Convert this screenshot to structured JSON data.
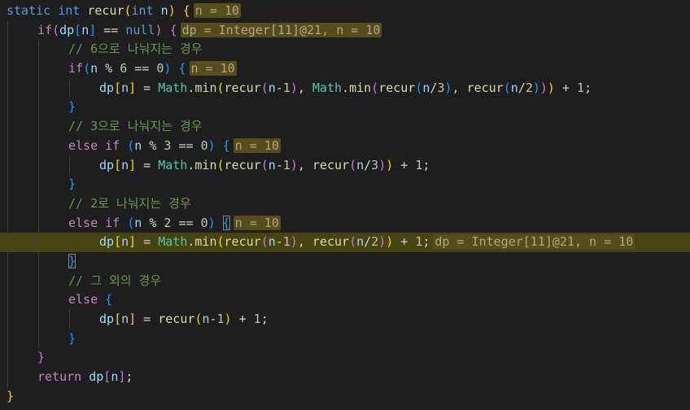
{
  "lines": [
    {
      "indent": 0,
      "tokens": [
        {
          "c": "kw",
          "t": "static"
        },
        {
          "c": "op",
          "t": " "
        },
        {
          "c": "kw",
          "t": "int"
        },
        {
          "c": "op",
          "t": " "
        },
        {
          "c": "fn",
          "t": "recur"
        },
        {
          "c": "b1",
          "t": "("
        },
        {
          "c": "kw",
          "t": "int"
        },
        {
          "c": "op",
          "t": " "
        },
        {
          "c": "var",
          "t": "n"
        },
        {
          "c": "b1",
          "t": ")"
        },
        {
          "c": "op",
          "t": " "
        },
        {
          "c": "b1",
          "t": "{"
        },
        {
          "c": "inl",
          "t": "n = 10"
        }
      ]
    },
    {
      "indent": 1,
      "tokens": [
        {
          "c": "ctl",
          "t": "if"
        },
        {
          "c": "b2",
          "t": "("
        },
        {
          "c": "var",
          "t": "dp"
        },
        {
          "c": "b3",
          "t": "["
        },
        {
          "c": "var",
          "t": "n"
        },
        {
          "c": "b3",
          "t": "]"
        },
        {
          "c": "op",
          "t": " == "
        },
        {
          "c": "kw",
          "t": "null"
        },
        {
          "c": "b2",
          "t": ")"
        },
        {
          "c": "op",
          "t": " "
        },
        {
          "c": "b2",
          "t": "{"
        },
        {
          "c": "inl",
          "t": "dp = Integer[11]@21, n = 10"
        }
      ]
    },
    {
      "indent": 2,
      "tokens": [
        {
          "c": "cm",
          "t": "// 6으로 나눠지는 경우"
        }
      ]
    },
    {
      "indent": 2,
      "tokens": [
        {
          "c": "ctl",
          "t": "if"
        },
        {
          "c": "b3",
          "t": "("
        },
        {
          "c": "var",
          "t": "n"
        },
        {
          "c": "op",
          "t": " % "
        },
        {
          "c": "num",
          "t": "6"
        },
        {
          "c": "op",
          "t": " == "
        },
        {
          "c": "num",
          "t": "0"
        },
        {
          "c": "b3",
          "t": ")"
        },
        {
          "c": "op",
          "t": " "
        },
        {
          "c": "b3",
          "t": "{"
        },
        {
          "c": "inl",
          "t": "n = 10"
        }
      ]
    },
    {
      "indent": 3,
      "tokens": [
        {
          "c": "var",
          "t": "dp"
        },
        {
          "c": "b1",
          "t": "["
        },
        {
          "c": "var",
          "t": "n"
        },
        {
          "c": "b1",
          "t": "]"
        },
        {
          "c": "op",
          "t": " = "
        },
        {
          "c": "ty",
          "t": "Math"
        },
        {
          "c": "op",
          "t": "."
        },
        {
          "c": "fn",
          "t": "min"
        },
        {
          "c": "b1",
          "t": "("
        },
        {
          "c": "fn",
          "t": "recur"
        },
        {
          "c": "b2",
          "t": "("
        },
        {
          "c": "var",
          "t": "n"
        },
        {
          "c": "op",
          "t": "-"
        },
        {
          "c": "num",
          "t": "1"
        },
        {
          "c": "b2",
          "t": ")"
        },
        {
          "c": "op",
          "t": ", "
        },
        {
          "c": "ty",
          "t": "Math"
        },
        {
          "c": "op",
          "t": "."
        },
        {
          "c": "fn",
          "t": "min"
        },
        {
          "c": "b2",
          "t": "("
        },
        {
          "c": "fn",
          "t": "recur"
        },
        {
          "c": "b3",
          "t": "("
        },
        {
          "c": "var",
          "t": "n"
        },
        {
          "c": "op",
          "t": "/"
        },
        {
          "c": "num",
          "t": "3"
        },
        {
          "c": "b3",
          "t": ")"
        },
        {
          "c": "op",
          "t": ", "
        },
        {
          "c": "fn",
          "t": "recur"
        },
        {
          "c": "b3",
          "t": "("
        },
        {
          "c": "var",
          "t": "n"
        },
        {
          "c": "op",
          "t": "/"
        },
        {
          "c": "num",
          "t": "2"
        },
        {
          "c": "b3",
          "t": ")"
        },
        {
          "c": "b2",
          "t": ")"
        },
        {
          "c": "b1",
          "t": ")"
        },
        {
          "c": "op",
          "t": " + "
        },
        {
          "c": "num",
          "t": "1"
        },
        {
          "c": "op",
          "t": ";"
        }
      ]
    },
    {
      "indent": 2,
      "tokens": [
        {
          "c": "b3",
          "t": "}"
        }
      ]
    },
    {
      "indent": 2,
      "tokens": [
        {
          "c": "cm",
          "t": "// 3으로 나눠지는 경우"
        }
      ]
    },
    {
      "indent": 2,
      "tokens": [
        {
          "c": "ctl",
          "t": "else"
        },
        {
          "c": "op",
          "t": " "
        },
        {
          "c": "ctl",
          "t": "if"
        },
        {
          "c": "op",
          "t": " "
        },
        {
          "c": "b3",
          "t": "("
        },
        {
          "c": "var",
          "t": "n"
        },
        {
          "c": "op",
          "t": " % "
        },
        {
          "c": "num",
          "t": "3"
        },
        {
          "c": "op",
          "t": " == "
        },
        {
          "c": "num",
          "t": "0"
        },
        {
          "c": "b3",
          "t": ")"
        },
        {
          "c": "op",
          "t": " "
        },
        {
          "c": "b3",
          "t": "{"
        },
        {
          "c": "inl",
          "t": "n = 10"
        }
      ]
    },
    {
      "indent": 3,
      "tokens": [
        {
          "c": "var",
          "t": "dp"
        },
        {
          "c": "b1",
          "t": "["
        },
        {
          "c": "var",
          "t": "n"
        },
        {
          "c": "b1",
          "t": "]"
        },
        {
          "c": "op",
          "t": " = "
        },
        {
          "c": "ty",
          "t": "Math"
        },
        {
          "c": "op",
          "t": "."
        },
        {
          "c": "fn",
          "t": "min"
        },
        {
          "c": "b1",
          "t": "("
        },
        {
          "c": "fn",
          "t": "recur"
        },
        {
          "c": "b2",
          "t": "("
        },
        {
          "c": "var",
          "t": "n"
        },
        {
          "c": "op",
          "t": "-"
        },
        {
          "c": "num",
          "t": "1"
        },
        {
          "c": "b2",
          "t": ")"
        },
        {
          "c": "op",
          "t": ", "
        },
        {
          "c": "fn",
          "t": "recur"
        },
        {
          "c": "b2",
          "t": "("
        },
        {
          "c": "var",
          "t": "n"
        },
        {
          "c": "op",
          "t": "/"
        },
        {
          "c": "num",
          "t": "3"
        },
        {
          "c": "b2",
          "t": ")"
        },
        {
          "c": "b1",
          "t": ")"
        },
        {
          "c": "op",
          "t": " + "
        },
        {
          "c": "num",
          "t": "1"
        },
        {
          "c": "op",
          "t": ";"
        }
      ]
    },
    {
      "indent": 2,
      "tokens": [
        {
          "c": "b3",
          "t": "}"
        }
      ]
    },
    {
      "indent": 2,
      "tokens": [
        {
          "c": "cm",
          "t": "// 2로 나눠지는 경우"
        }
      ]
    },
    {
      "indent": 2,
      "tokens": [
        {
          "c": "ctl",
          "t": "else"
        },
        {
          "c": "op",
          "t": " "
        },
        {
          "c": "ctl",
          "t": "if"
        },
        {
          "c": "op",
          "t": " "
        },
        {
          "c": "b3",
          "t": "("
        },
        {
          "c": "var",
          "t": "n"
        },
        {
          "c": "op",
          "t": " % "
        },
        {
          "c": "num",
          "t": "2"
        },
        {
          "c": "op",
          "t": " == "
        },
        {
          "c": "num",
          "t": "0"
        },
        {
          "c": "b3",
          "t": ")"
        },
        {
          "c": "op",
          "t": " "
        },
        {
          "c": "b3 match",
          "t": "{"
        },
        {
          "c": "inl",
          "t": "n = 10"
        }
      ]
    },
    {
      "indent": 3,
      "current": true,
      "tokens": [
        {
          "c": "var",
          "t": "dp"
        },
        {
          "c": "b1",
          "t": "["
        },
        {
          "c": "var",
          "t": "n"
        },
        {
          "c": "b1",
          "t": "]"
        },
        {
          "c": "op",
          "t": " = "
        },
        {
          "c": "ty",
          "t": "Math"
        },
        {
          "c": "op",
          "t": "."
        },
        {
          "c": "fn",
          "t": "min"
        },
        {
          "c": "b1",
          "t": "("
        },
        {
          "c": "fn",
          "t": "recur"
        },
        {
          "c": "b2",
          "t": "("
        },
        {
          "c": "var",
          "t": "n"
        },
        {
          "c": "op",
          "t": "-"
        },
        {
          "c": "num",
          "t": "1"
        },
        {
          "c": "b2",
          "t": ")"
        },
        {
          "c": "op",
          "t": ", "
        },
        {
          "c": "fn",
          "t": "recur"
        },
        {
          "c": "b2",
          "t": "("
        },
        {
          "c": "var",
          "t": "n"
        },
        {
          "c": "op",
          "t": "/"
        },
        {
          "c": "num",
          "t": "2"
        },
        {
          "c": "b2",
          "t": ")"
        },
        {
          "c": "b1",
          "t": ")"
        },
        {
          "c": "op",
          "t": " + "
        },
        {
          "c": "num",
          "t": "1"
        },
        {
          "c": "op",
          "t": ";"
        },
        {
          "c": "inl",
          "t": "dp = Integer[11]@21, n = 10"
        }
      ]
    },
    {
      "indent": 2,
      "tokens": [
        {
          "c": "b3 match",
          "t": "}"
        }
      ]
    },
    {
      "indent": 2,
      "tokens": [
        {
          "c": "cm",
          "t": "// 그 외의 경우"
        }
      ]
    },
    {
      "indent": 2,
      "tokens": [
        {
          "c": "ctl",
          "t": "else"
        },
        {
          "c": "op",
          "t": " "
        },
        {
          "c": "b3",
          "t": "{"
        }
      ]
    },
    {
      "indent": 3,
      "tokens": [
        {
          "c": "var",
          "t": "dp"
        },
        {
          "c": "b1",
          "t": "["
        },
        {
          "c": "var",
          "t": "n"
        },
        {
          "c": "b1",
          "t": "]"
        },
        {
          "c": "op",
          "t": " = "
        },
        {
          "c": "fn",
          "t": "recur"
        },
        {
          "c": "b1",
          "t": "("
        },
        {
          "c": "var",
          "t": "n"
        },
        {
          "c": "op",
          "t": "-"
        },
        {
          "c": "num",
          "t": "1"
        },
        {
          "c": "b1",
          "t": ")"
        },
        {
          "c": "op",
          "t": " + "
        },
        {
          "c": "num",
          "t": "1"
        },
        {
          "c": "op",
          "t": ";"
        }
      ]
    },
    {
      "indent": 2,
      "tokens": [
        {
          "c": "b3",
          "t": "}"
        }
      ]
    },
    {
      "indent": 1,
      "tokens": [
        {
          "c": "b2",
          "t": "}"
        }
      ]
    },
    {
      "indent": 1,
      "tokens": [
        {
          "c": "ctl",
          "t": "return"
        },
        {
          "c": "op",
          "t": " "
        },
        {
          "c": "var",
          "t": "dp"
        },
        {
          "c": "b2",
          "t": "["
        },
        {
          "c": "var",
          "t": "n"
        },
        {
          "c": "b2",
          "t": "]"
        },
        {
          "c": "op",
          "t": ";"
        }
      ]
    },
    {
      "indent": 0,
      "tokens": [
        {
          "c": "b1",
          "t": "}"
        }
      ]
    }
  ],
  "colors": {
    "background": "#1e1e1e",
    "current_line": "#484313",
    "inline_value_bg": "#564d1d"
  }
}
